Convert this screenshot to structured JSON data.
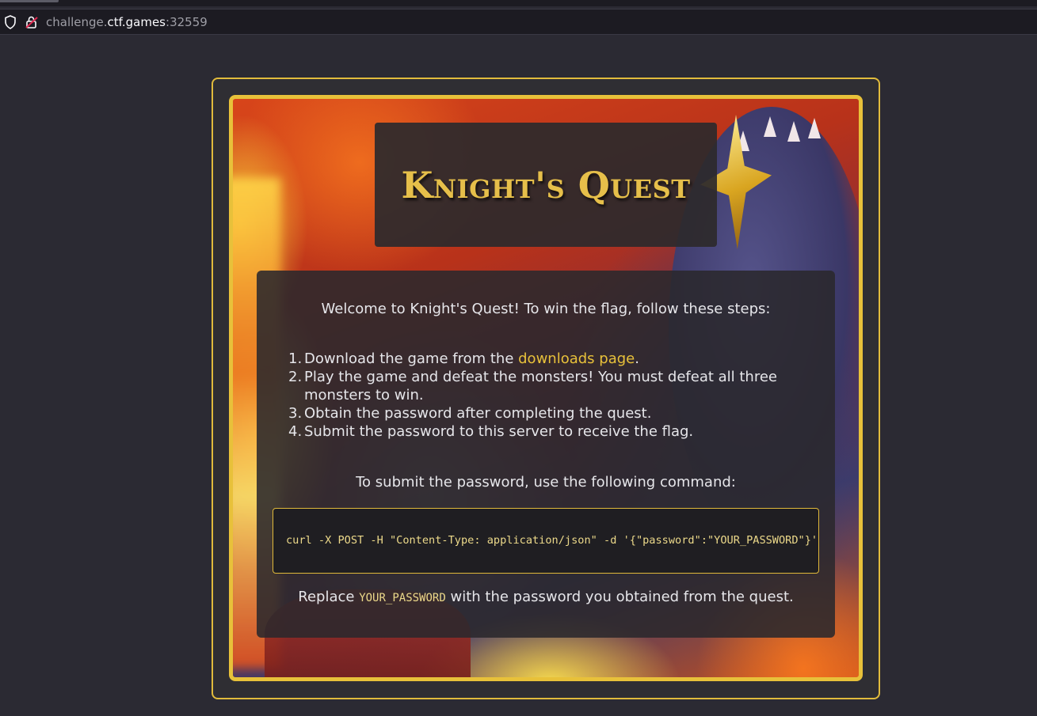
{
  "browser": {
    "url_prefix": "challenge.",
    "url_host": "ctf.games",
    "url_suffix": ":32559"
  },
  "page": {
    "title": "Knight's Quest",
    "welcome": "Welcome to Knight's Quest! To win the flag, follow these steps:",
    "steps": [
      {
        "num": "1.",
        "before": "Download the game from the ",
        "link": "downloads page",
        "after": "."
      },
      {
        "num": "2.",
        "text": "Play the game and defeat the monsters! You must defeat all three monsters to win."
      },
      {
        "num": "3.",
        "text": "Obtain the password after completing the quest."
      },
      {
        "num": "4.",
        "text": "Submit the password to this server to receive the flag."
      }
    ],
    "submit_intro": "To submit the password, use the following command:",
    "command": "curl -X POST -H \"Content-Type: application/json\" -d '{\"password\":\"YOUR_PASSWORD\"}' ht",
    "replace_before": "Replace ",
    "replace_code": "YOUR_PASSWORD",
    "replace_after": " with the password you obtained from the quest."
  },
  "colors": {
    "accent_gold": "#e8c13a",
    "background": "#2b2a33"
  }
}
